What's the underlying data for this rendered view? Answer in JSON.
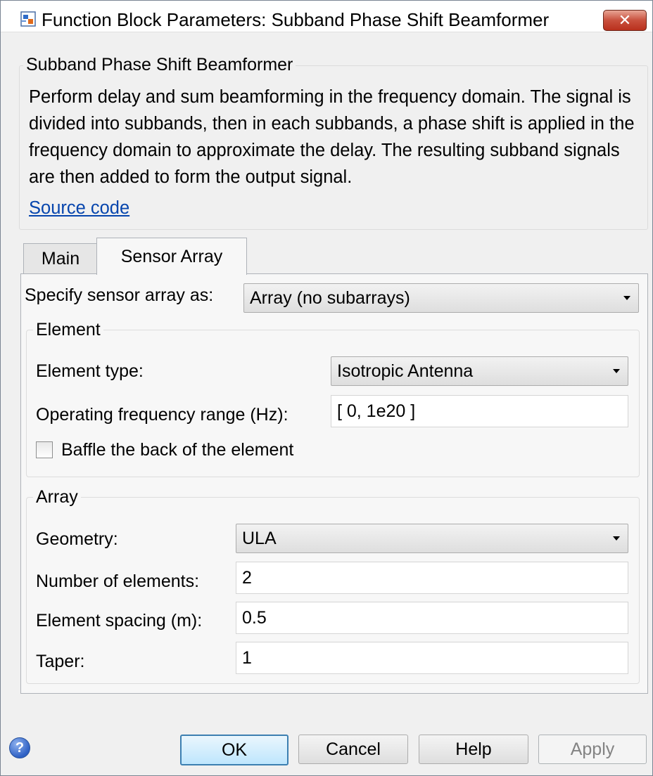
{
  "window": {
    "title": "Function Block Parameters: Subband Phase Shift Beamformer",
    "close_icon": "close-x-icon"
  },
  "block": {
    "title": "Subband Phase Shift Beamformer",
    "description": "Perform delay and sum beamforming in the frequency domain. The signal is divided into subbands, then in each subbands, a phase shift is applied in the frequency domain to approximate the delay. The resulting subband signals are then added to form the output signal.",
    "source_link": "Source code"
  },
  "tabs": [
    {
      "label": "Main",
      "active": false
    },
    {
      "label": "Sensor Array",
      "active": true
    }
  ],
  "sensor_array": {
    "specify_label": "Specify sensor array as:",
    "specify_value": "Array (no subarrays)"
  },
  "element": {
    "group_title": "Element",
    "type_label": "Element type:",
    "type_value": "Isotropic Antenna",
    "freq_label": "Operating frequency range (Hz):",
    "freq_value": "[ 0, 1e20 ]",
    "baffle_label": "Baffle the back of the element",
    "baffle_checked": false
  },
  "array": {
    "group_title": "Array",
    "geometry_label": "Geometry:",
    "geometry_value": "ULA",
    "num_elements_label": "Number of elements:",
    "num_elements_value": "2",
    "spacing_label": "Element spacing (m):",
    "spacing_value": "0.5",
    "taper_label": "Taper:",
    "taper_value": "1"
  },
  "buttons": {
    "ok": "OK",
    "cancel": "Cancel",
    "help": "Help",
    "apply": "Apply"
  },
  "icons": {
    "help": "?"
  }
}
